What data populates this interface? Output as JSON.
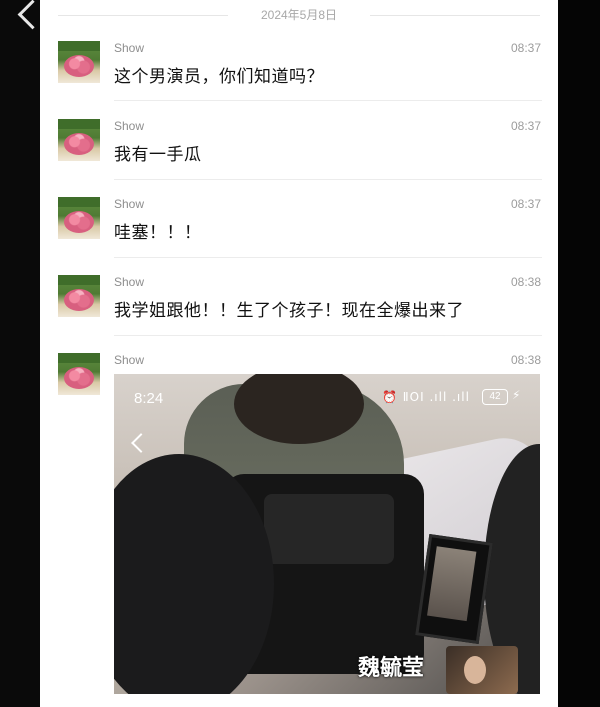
{
  "date_divider": "2024年5月8日",
  "messages": [
    {
      "sender": "Show",
      "time": "08:37",
      "text": "这个男演员，你们知道吗？"
    },
    {
      "sender": "Show",
      "time": "08:37",
      "text": "我有一手瓜"
    },
    {
      "sender": "Show",
      "time": "08:37",
      "text": "哇塞！！！"
    },
    {
      "sender": "Show",
      "time": "08:38",
      "text": "我学姐跟他！！生了个孩子！现在全爆出来了"
    },
    {
      "sender": "Show",
      "time": "08:38",
      "text": ""
    }
  ],
  "photo": {
    "status_time": "8:24",
    "status_icons": "⏰ ⅡOI .ıll .ıll",
    "battery": "42",
    "caption": "魏毓莹"
  },
  "colors": {
    "chat_bg": "#ffffff",
    "text": "#111111",
    "meta": "#9c9c9c",
    "outer_bg": "#000000"
  },
  "icons": [
    "back-icon",
    "photo-back-icon",
    "alarm-icon",
    "signal-icon",
    "battery-icon",
    "charging-icon"
  ]
}
